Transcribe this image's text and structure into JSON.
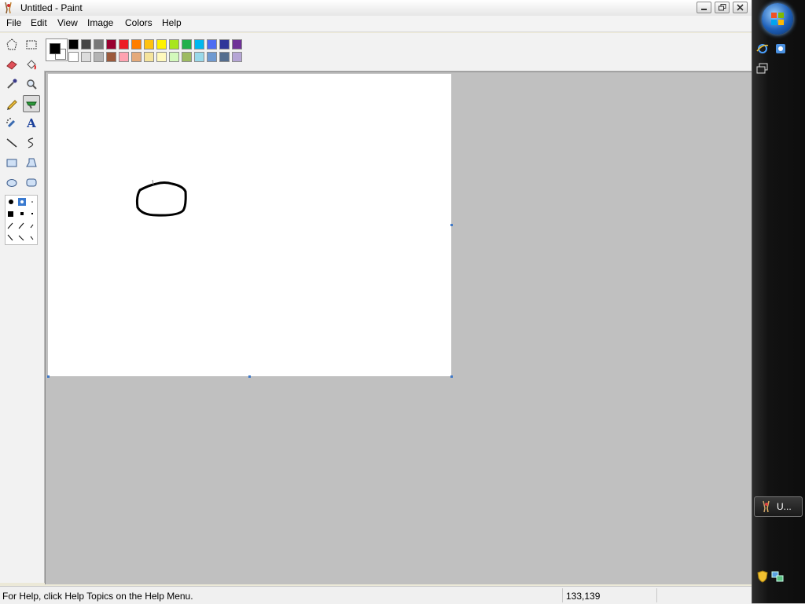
{
  "window": {
    "title": "Untitled - Paint"
  },
  "title_buttons": {
    "minimize": "minimize",
    "maximize": "restore",
    "close": "close"
  },
  "menu": [
    "File",
    "Edit",
    "View",
    "Image",
    "Colors",
    "Help"
  ],
  "tools": [
    {
      "name": "free-form-select",
      "icon": "star-select-icon"
    },
    {
      "name": "select",
      "icon": "rect-select-icon"
    },
    {
      "name": "eraser",
      "icon": "eraser-icon"
    },
    {
      "name": "fill",
      "icon": "fill-bucket-icon"
    },
    {
      "name": "pick-color",
      "icon": "eyedropper-icon"
    },
    {
      "name": "magnifier",
      "icon": "magnifier-icon"
    },
    {
      "name": "pencil",
      "icon": "pencil-icon"
    },
    {
      "name": "brush",
      "icon": "brush-icon",
      "selected": true
    },
    {
      "name": "airbrush",
      "icon": "airbrush-icon"
    },
    {
      "name": "text",
      "icon": "text-icon",
      "label": "A"
    },
    {
      "name": "line",
      "icon": "line-icon"
    },
    {
      "name": "curve",
      "icon": "curve-icon"
    },
    {
      "name": "rectangle",
      "icon": "rectangle-icon"
    },
    {
      "name": "polygon",
      "icon": "polygon-icon"
    },
    {
      "name": "ellipse",
      "icon": "ellipse-icon"
    },
    {
      "name": "rounded-rectangle",
      "icon": "rounded-rect-icon"
    }
  ],
  "palette": {
    "foreground": "#000000",
    "background": "#ffffff",
    "top_row": [
      "#000000",
      "#464646",
      "#787878",
      "#990030",
      "#ed1c24",
      "#ff7e00",
      "#ffc20e",
      "#fff200",
      "#a8e61d",
      "#22b14c",
      "#00b7ef",
      "#4d6df3",
      "#2f3699",
      "#6f3198"
    ],
    "bottom_row": [
      "#ffffff",
      "#dcdcdc",
      "#b4b4b4",
      "#9c5a3c",
      "#ffa3b1",
      "#e5aa7a",
      "#f5e49c",
      "#fff9bd",
      "#d3f9bc",
      "#9dbb61",
      "#99d9ea",
      "#709ad1",
      "#546d8e",
      "#b5a5d5"
    ]
  },
  "status": {
    "help_text": "For Help, click Help Topics on the Help Menu.",
    "coords": "133,139"
  },
  "taskbar": {
    "active_label": "U..."
  }
}
